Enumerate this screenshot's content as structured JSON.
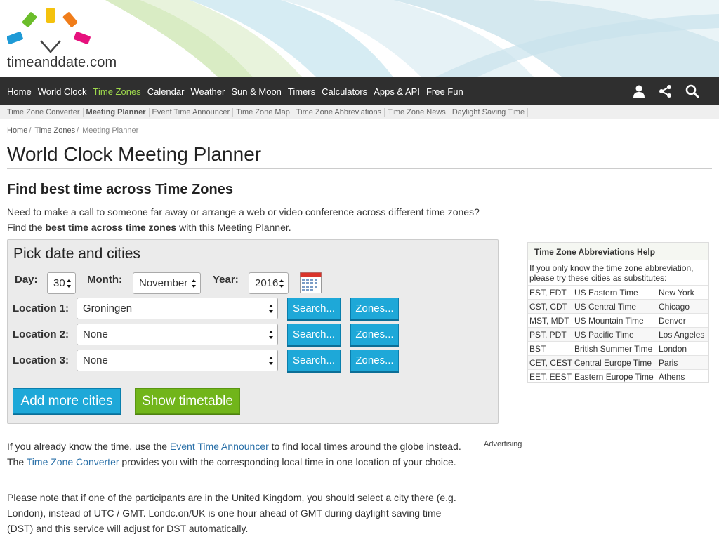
{
  "logo": {
    "text": "timeanddate.com"
  },
  "nav": {
    "items": [
      {
        "label": "Home",
        "active": false
      },
      {
        "label": "World Clock",
        "active": false
      },
      {
        "label": "Time Zones",
        "active": true
      },
      {
        "label": "Calendar",
        "active": false
      },
      {
        "label": "Weather",
        "active": false
      },
      {
        "label": "Sun & Moon",
        "active": false
      },
      {
        "label": "Timers",
        "active": false
      },
      {
        "label": "Calculators",
        "active": false
      },
      {
        "label": "Apps & API",
        "active": false
      },
      {
        "label": "Free Fun",
        "active": false
      }
    ],
    "icons": [
      "user-icon",
      "share-icon",
      "search-icon"
    ]
  },
  "subnav": {
    "items": [
      {
        "label": "Time Zone Converter",
        "active": false
      },
      {
        "label": "Meeting Planner",
        "active": true
      },
      {
        "label": "Event Time Announcer",
        "active": false
      },
      {
        "label": "Time Zone Map",
        "active": false
      },
      {
        "label": "Time Zone Abbreviations",
        "active": false
      },
      {
        "label": "Time Zone News",
        "active": false
      },
      {
        "label": "Daylight Saving Time",
        "active": false
      }
    ]
  },
  "breadcrumb": {
    "home": "Home",
    "time_zones": "Time Zones",
    "current": "Meeting Planner",
    "sep": "/"
  },
  "page": {
    "title": "World Clock Meeting Planner",
    "subtitle": "Find best time across Time Zones",
    "intro_line1": "Need to make a call to someone far away or arrange a web or video conference across different time zones?",
    "intro_line2_pre": "Find the ",
    "intro_line2_bold": "best time across time zones",
    "intro_line2_post": " with this Meeting Planner."
  },
  "planner": {
    "title": "Pick date and cities",
    "day_label": "Day:",
    "day_value": "30",
    "month_label": "Month:",
    "month_value": "November",
    "year_label": "Year:",
    "year_value": "2016",
    "locations": [
      {
        "label": "Location 1:",
        "value": "Groningen"
      },
      {
        "label": "Location 2:",
        "value": "None"
      },
      {
        "label": "Location 3:",
        "value": "None"
      }
    ],
    "search_label": "Search...",
    "zones_label": "Zones...",
    "add_cities_label": "Add more cities",
    "show_timetable_label": "Show timetable"
  },
  "help": {
    "title": "Time Zone Abbreviations Help",
    "desc": "If you only know the time zone abbreviation, please try these cities as substitutes:",
    "rows": [
      {
        "abbr": "EST, EDT",
        "zone": "US Eastern Time",
        "city": "New York"
      },
      {
        "abbr": "CST, CDT",
        "zone": "US Central Time",
        "city": "Chicago"
      },
      {
        "abbr": "MST, MDT",
        "zone": "US Mountain Time",
        "city": "Denver"
      },
      {
        "abbr": "PST, PDT",
        "zone": "US Pacific Time",
        "city": "Los Angeles"
      },
      {
        "abbr": "BST",
        "zone": "British Summer Time",
        "city": "London"
      },
      {
        "abbr": "CET, CEST",
        "zone": "Central Europe Time",
        "city": "Paris"
      },
      {
        "abbr": "EET, EEST",
        "zone": "Eastern Europe Time",
        "city": "Athens"
      }
    ]
  },
  "advertising": "Advertising",
  "para1": {
    "pre": "If you already know the time, use the ",
    "link1": "Event Time Announcer",
    "mid": " to find local times around the globe instead. The ",
    "link2": "Time Zone Converter",
    "post": " provides you with the corresponding local time in one location of your choice."
  },
  "para2": "Please note that if one of the participants are in the United Kingdom, you should select a city there (e.g. London), instead of UTC / GMT. Londc.on/UK is one hour ahead of GMT during daylight saving time (DST) and this service will adjust for DST automatically.",
  "colors": {
    "nav_bg": "#2f2f2f",
    "nav_active": "#9ed84c",
    "button_blue": "#1ea8d8",
    "button_green": "#71b51a",
    "link": "#2a70a8"
  }
}
